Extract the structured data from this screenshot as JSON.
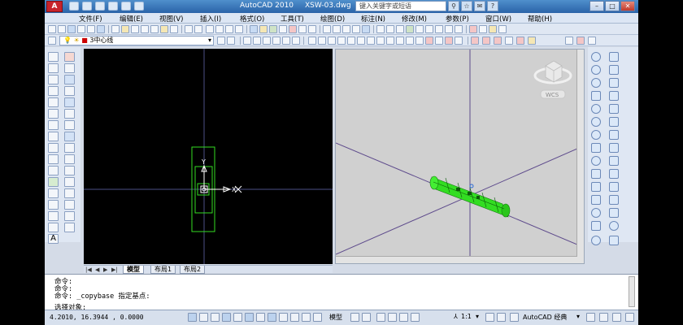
{
  "title": {
    "app_name": "AutoCAD 2010",
    "document": "XSW-03.dwg",
    "search_placeholder": "键入关键字或短语"
  },
  "menus": [
    "文件(F)",
    "编辑(E)",
    "视图(V)",
    "插入(I)",
    "格式(O)",
    "工具(T)",
    "绘图(D)",
    "标注(N)",
    "修改(M)",
    "参数(P)",
    "窗口(W)",
    "帮助(H)"
  ],
  "layer": {
    "current": "3中心线"
  },
  "viewcube": {
    "wcs": "WCS"
  },
  "layout_tabs": {
    "model": "模型",
    "layout1": "布局1",
    "layout2": "布局2"
  },
  "command_history": [
    "命令:",
    "命令:",
    "命令: _copybase 指定基点:"
  ],
  "command_prompt": "选择对象:",
  "status": {
    "coords": "4.2010,  16.3944 , 0.0000",
    "model_label": "模型",
    "annotation_scale": "1:1",
    "workspace": "AutoCAD 经典"
  },
  "colors": {
    "drawing_bg": "#000000",
    "viewport_3d_bg": "#d0d0d0",
    "pipe_green": "#33dd22",
    "crosshair_left": "#4b4f86",
    "axes_right": "#5e4b8c"
  },
  "icons": {
    "viewcube": "viewcube-icon",
    "ucs": "ucs-icon",
    "pipe": "3d-pipe-solid"
  }
}
